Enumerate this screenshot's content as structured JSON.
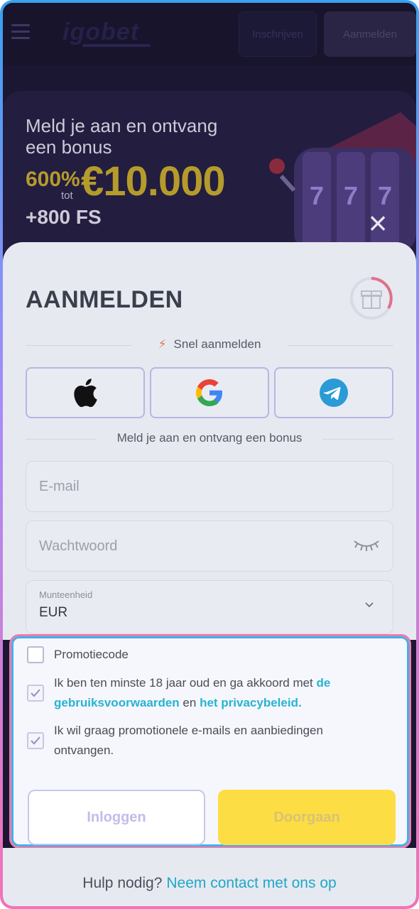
{
  "header": {
    "logo": "igobet",
    "register_label": "Inschrijven",
    "login_label": "Aanmelden"
  },
  "banner": {
    "title_line1": "Meld je aan en ontvang",
    "title_line2": "een bonus",
    "percent": "600%",
    "tot": "tot",
    "amount": "€10.000",
    "free_spins": "+800 FS",
    "close_icon": "close-icon"
  },
  "form": {
    "title": "AANMELDEN",
    "quick_signup": "Snel aanmelden",
    "social": [
      "apple-icon",
      "google-icon",
      "telegram-icon"
    ],
    "bonus_text": "Meld je aan en ontvang een bonus",
    "email_placeholder": "E-mail",
    "password_placeholder": "Wachtwoord",
    "currency_label": "Munteenheid",
    "currency_value": "EUR"
  },
  "consent": {
    "promo_code": "Promotiecode",
    "promo_checked": false,
    "terms_prefix": "Ik ben ten minste 18 jaar oud en ga akkoord met",
    "terms_link": "de gebruiksvoorwaarden",
    "terms_and": "en",
    "privacy_link": "het privacybeleid.",
    "terms_checked": true,
    "marketing_text": "Ik wil graag promotionele e-mails en aanbiedingen ontvangen.",
    "marketing_checked": true
  },
  "actions": {
    "login_label": "Inloggen",
    "continue_label": "Doorgaan"
  },
  "help": {
    "question": "Hulp nodig?",
    "contact_link": "Neem contact met ons op"
  },
  "colors": {
    "accent_yellow": "#fddd44",
    "link_cyan": "#26b3d3",
    "highlight_pink": "#ee7aa9",
    "highlight_blue": "#3fb2ec"
  }
}
